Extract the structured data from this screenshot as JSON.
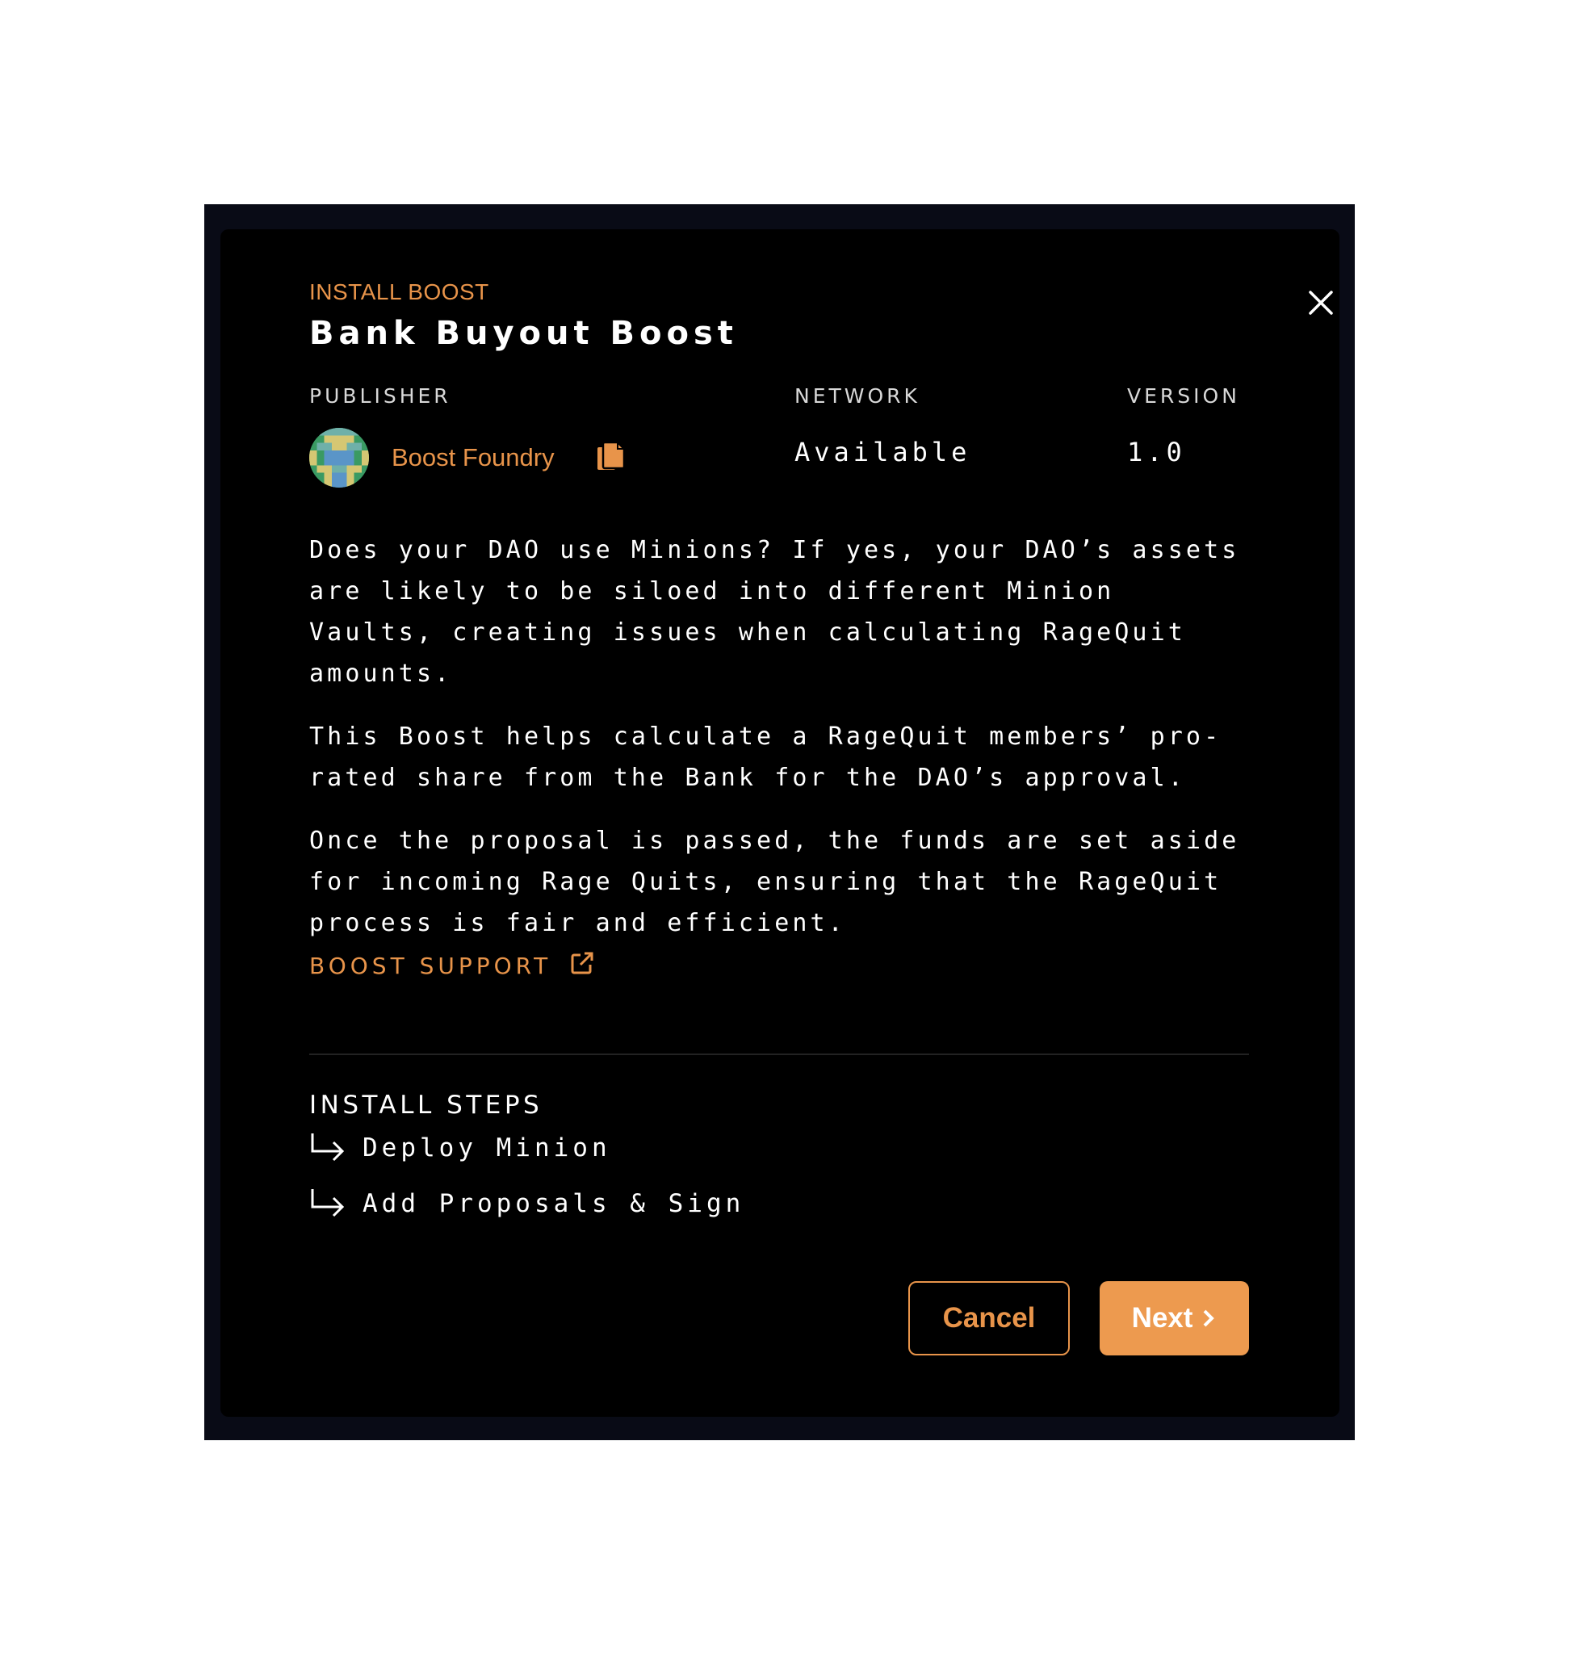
{
  "modal": {
    "eyebrow": "INSTALL BOOST",
    "title": "Bank Buyout Boost",
    "close_icon": "close-icon"
  },
  "meta": {
    "publisher_label": "PUBLISHER",
    "network_label": "NETWORK",
    "version_label": "VERSION",
    "publisher_name": "Boost Foundry",
    "network_value": "Available",
    "version_value": "1.0",
    "copy_icon": "copy-icon"
  },
  "description": {
    "p1": "Does your DAO use Minions? If yes, your DAO’s assets are likely to be siloed into different Minion Vaults, creating issues when calculating RageQuit amounts.",
    "p2": "This Boost helps calculate a RageQuit members’ pro-rated share from the Bank for the DAO’s approval.",
    "p3": "Once the proposal is passed, the funds are set aside for incoming Rage Quits, ensuring that the RageQuit process is fair and efficient."
  },
  "support": {
    "label": "BOOST SUPPORT",
    "icon": "external-link-icon"
  },
  "steps": {
    "heading": "INSTALL STEPS",
    "items": [
      {
        "label": "Deploy Minion",
        "icon": "arrow-return-right-icon"
      },
      {
        "label": "Add Proposals & Sign",
        "icon": "arrow-return-right-icon"
      }
    ]
  },
  "actions": {
    "cancel": "Cancel",
    "next": "Next",
    "next_icon": "chevron-right-icon"
  },
  "colors": {
    "accent": "#e8944a",
    "background": "#000000",
    "backdrop": "#090b16"
  }
}
